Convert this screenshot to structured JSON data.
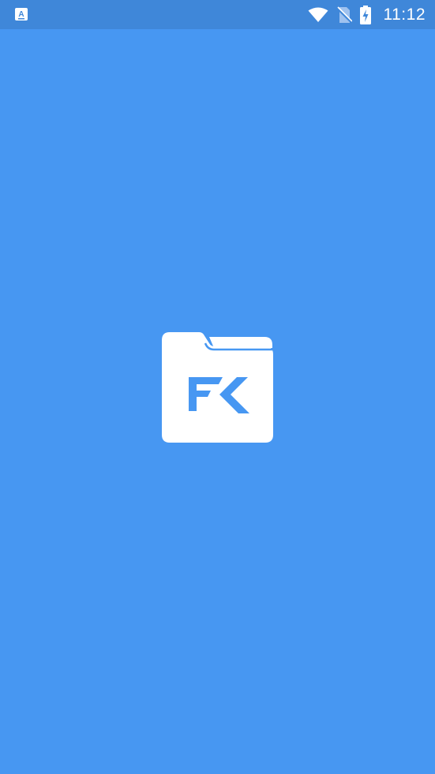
{
  "status_bar": {
    "time": "11:12",
    "icons": [
      "keyboard-a-icon",
      "wifi-icon",
      "no-sim-icon",
      "battery-charging-icon"
    ]
  },
  "colors": {
    "background": "#4797f2",
    "status_bar": "#3f87d9",
    "logo": "#ffffff"
  },
  "splash": {
    "logo_icon": "fk-folder-logo-icon"
  }
}
